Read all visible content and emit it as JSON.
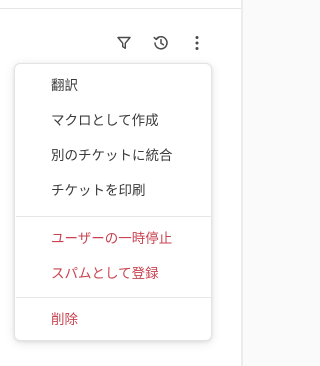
{
  "toolbar": {
    "icons": [
      {
        "name": "filter-icon"
      },
      {
        "name": "history-icon"
      },
      {
        "name": "more-vertical-icon"
      }
    ]
  },
  "menu": {
    "items": [
      {
        "label": "翻訳"
      },
      {
        "label": "マクロとして作成"
      },
      {
        "label": "別のチケットに統合"
      },
      {
        "label": "チケットを印刷"
      },
      {
        "label": "ユーザーの一時停止"
      },
      {
        "label": "スパムとして登録"
      },
      {
        "label": "削除"
      }
    ]
  },
  "colors": {
    "danger": "#c8434f",
    "text": "#3a3a3a",
    "icon": "#4a4a4a"
  }
}
